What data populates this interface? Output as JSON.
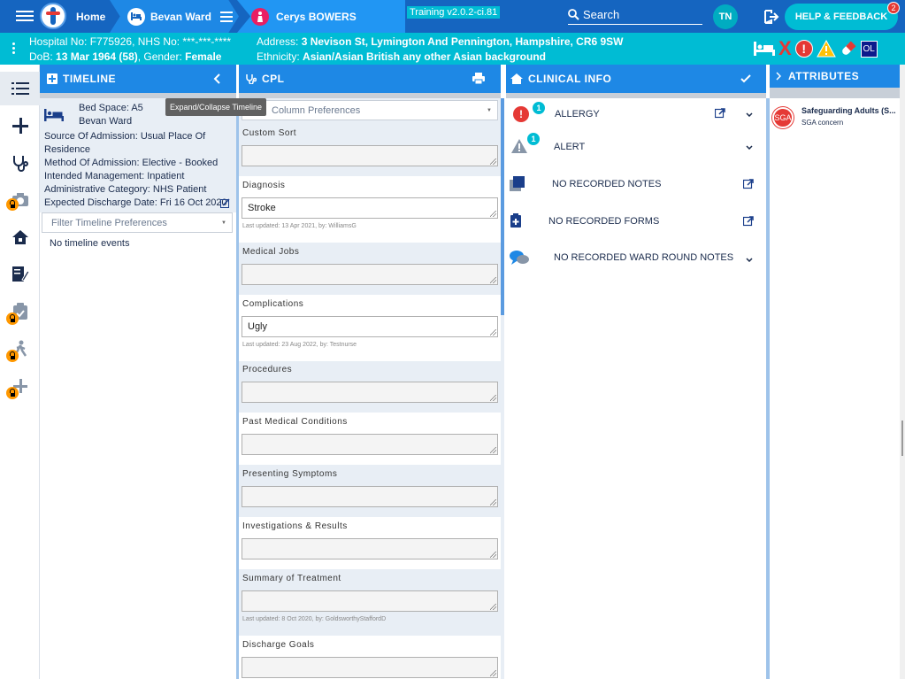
{
  "topbar": {
    "home_label": "Home",
    "ward_label": "Bevan Ward",
    "patient_label": "Cerys BOWERS",
    "version": "Training v2.0.2-ci.81",
    "search_label": "Search",
    "user_initials": "TN",
    "help_label": "HELP & FEEDBACK",
    "help_count": "2"
  },
  "patient": {
    "line1": "Hospital No: F775926, NHS No: ***-***-****",
    "dob_prefix": "DoB: ",
    "dob_value": "13 Mar 1964 (58)",
    "gender_prefix": ", Gender: ",
    "gender_value": "Female",
    "address_prefix": "Address: ",
    "address_value": "3 Nevison St, Lymington And Pennington, Hampshire, CR6 9SW",
    "ethnicity_prefix": "Ethnicity: ",
    "ethnicity_value": "Asian/Asian British any other Asian background",
    "icon_alert": "!",
    "icon_ol": "OL",
    "icon_x": "X"
  },
  "panels": {
    "timeline": "TIMELINE",
    "cpl": "CPL",
    "clinical": "CLINICAL INFO",
    "attributes": "ATTRIBUTES"
  },
  "timeline": {
    "tooltip": "Expand/Collapse Timeline",
    "bed_space": "Bed Space: A5",
    "ward": "Bevan Ward",
    "lines": [
      "Source Of Admission: Usual Place Of",
      "Residence",
      "Method Of Admission: Elective - Booked",
      "Intended Management: Inpatient",
      "Administrative Category: NHS Patient",
      "Expected Discharge Date: Fri 16 Oct 2020"
    ],
    "filter_placeholder": "Filter Timeline Preferences",
    "empty": "No timeline events"
  },
  "cpl": {
    "column_prefs": "Column Preferences",
    "sections": [
      {
        "label": "Custom Sort",
        "value": "",
        "meta": ""
      },
      {
        "label": "Diagnosis",
        "value": "Stroke",
        "meta": "Last updated: 13 Apr 2021, by: WilliamsG"
      },
      {
        "label": "Medical Jobs",
        "value": "",
        "meta": ""
      },
      {
        "label": "Complications",
        "value": "Ugly",
        "meta": "Last updated: 23 Aug 2022, by: Testnurse"
      },
      {
        "label": "Procedures",
        "value": "",
        "meta": ""
      },
      {
        "label": "Past Medical Conditions",
        "value": "",
        "meta": ""
      },
      {
        "label": "Presenting Symptoms",
        "value": "",
        "meta": ""
      },
      {
        "label": "Investigations & Results",
        "value": "",
        "meta": ""
      },
      {
        "label": "Summary of Treatment",
        "value": "",
        "meta": "Last updated: 8 Oct 2020, by: GoldsworthyStaffordD"
      },
      {
        "label": "Discharge Goals",
        "value": "",
        "meta": ""
      }
    ]
  },
  "clinical": {
    "allergy": "ALLERGY",
    "allergy_count": "1",
    "alert": "ALERT",
    "alert_count": "1",
    "notes": "NO RECORDED NOTES",
    "forms": "NO RECORDED FORMS",
    "ward_round": "NO RECORDED WARD ROUND NOTES"
  },
  "attributes": {
    "sga_badge": "SGA",
    "title": "Safeguarding Adults (S...",
    "subtitle": "SGA concern"
  }
}
